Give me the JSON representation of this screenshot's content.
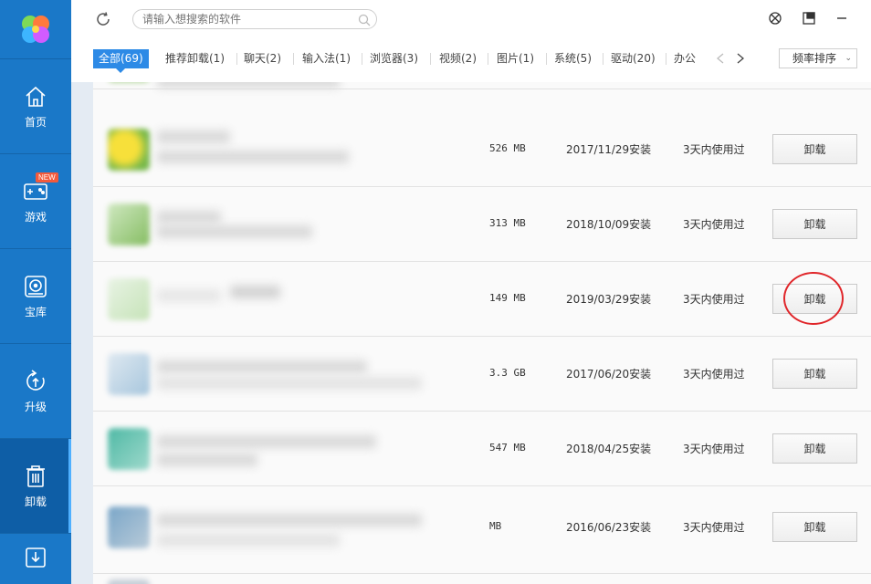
{
  "sidebar": {
    "items": [
      {
        "label": "首页",
        "icon": "home-icon"
      },
      {
        "label": "游戏",
        "icon": "gamepad-icon",
        "badge": "NEW"
      },
      {
        "label": "宝库",
        "icon": "disc-icon"
      },
      {
        "label": "升级",
        "icon": "upgrade-icon"
      },
      {
        "label": "卸载",
        "icon": "trash-icon",
        "active": true
      },
      {
        "label": "",
        "icon": "download-icon"
      }
    ]
  },
  "topbar": {
    "search_placeholder": "请输入想搜索的软件"
  },
  "tabs": [
    {
      "label": "全部(69)",
      "active": true
    },
    {
      "label": "推荐卸载(1)"
    },
    {
      "label": "聊天(2)"
    },
    {
      "label": "输入法(1)"
    },
    {
      "label": "浏览器(3)"
    },
    {
      "label": "视频(2)"
    },
    {
      "label": "图片(1)"
    },
    {
      "label": "系统(5)"
    },
    {
      "label": "驱动(20)"
    },
    {
      "label": "办公"
    }
  ],
  "sort": {
    "label": "频率排序"
  },
  "rows": [
    {
      "size": "526 MB",
      "date": "2017/11/29安装",
      "used": "3天内使用过",
      "button": "卸载"
    },
    {
      "size": "313 MB",
      "date": "2018/10/09安装",
      "used": "3天内使用过",
      "button": "卸载"
    },
    {
      "size": "149 MB",
      "date": "2019/03/29安装",
      "used": "3天内使用过",
      "button": "卸载"
    },
    {
      "size": "3.3 GB",
      "date": "2017/06/20安装",
      "used": "3天内使用过",
      "button": "卸载"
    },
    {
      "size": "547 MB",
      "date": "2018/04/25安装",
      "used": "3天内使用过",
      "button": "卸载"
    },
    {
      "size": "MB",
      "date": "2016/06/23安装",
      "used": "3天内使用过",
      "button": "卸载"
    }
  ],
  "colors": {
    "sidebar": "#1a78c8",
    "sidebar_active": "#0e5ea6",
    "tab_active": "#2d8ae6",
    "highlight_circle": "#e0262a"
  }
}
